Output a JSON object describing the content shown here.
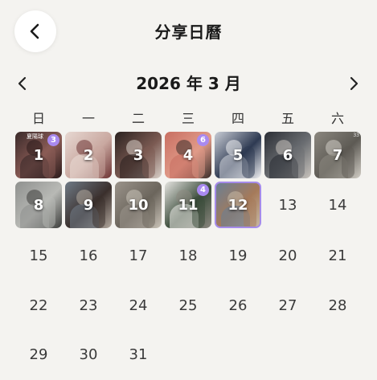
{
  "header": {
    "title": "分享日曆",
    "back_icon": "chevron-left-icon"
  },
  "calendar": {
    "month_label": "2026 年 3 月",
    "prev_icon": "chevron-left-icon",
    "next_icon": "chevron-right-icon",
    "weekdays": [
      "日",
      "一",
      "二",
      "三",
      "四",
      "五",
      "六"
    ],
    "selected_day": "12",
    "accent_color": "#a98af0",
    "photo_days": [
      {
        "day": "1",
        "badge": "3",
        "tag": "夏陽球",
        "colors": [
          "#3a2a2a",
          "#8a5b55",
          "#2a1a1a"
        ]
      },
      {
        "day": "2",
        "colors": [
          "#e7d8d2",
          "#c9a8a0",
          "#6e3434"
        ]
      },
      {
        "day": "3",
        "colors": [
          "#2b2220",
          "#7b5a52",
          "#d8cfc8"
        ]
      },
      {
        "day": "4",
        "badge": "6",
        "colors": [
          "#c86f62",
          "#e09a88",
          "#3a2e2a"
        ]
      },
      {
        "day": "5",
        "colors": [
          "#c9cdd6",
          "#2e3a52",
          "#f0f0f2"
        ]
      },
      {
        "day": "6",
        "colors": [
          "#2c2f36",
          "#6b6e72",
          "#c8c3bd"
        ]
      },
      {
        "day": "7",
        "tag_r": "33",
        "colors": [
          "#8b877f",
          "#5d5a54",
          "#d2cec6"
        ]
      },
      {
        "day": "8",
        "colors": [
          "#8f918f",
          "#b8b9b5",
          "#3c3d3b"
        ]
      },
      {
        "day": "9",
        "colors": [
          "#6f7a86",
          "#3a2f2c",
          "#b3a99f"
        ]
      },
      {
        "day": "10",
        "colors": [
          "#9a938a",
          "#6b655c",
          "#cbc4b9"
        ]
      },
      {
        "day": "11",
        "badge": "4",
        "colors": [
          "#e5e4e0",
          "#3a4b3a",
          "#8c8880"
        ]
      },
      {
        "day": "12",
        "colors": [
          "#6b7f92",
          "#a57a5a",
          "#c7b8a4"
        ]
      }
    ],
    "plain_days": [
      "13",
      "14",
      "15",
      "16",
      "17",
      "18",
      "19",
      "20",
      "21",
      "22",
      "23",
      "24",
      "25",
      "26",
      "27",
      "28",
      "29",
      "30",
      "31"
    ]
  }
}
